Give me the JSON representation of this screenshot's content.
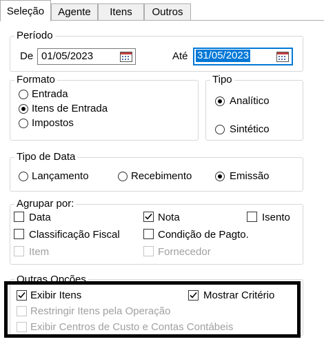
{
  "tabs": [
    "Seleção",
    "Agente",
    "Itens",
    "Outros"
  ],
  "periodo": {
    "legend": "Período",
    "de_label": "De",
    "de_value": "01/05/2023",
    "ate_label": "Até",
    "ate_value": "31/05/2023"
  },
  "formato": {
    "legend": "Formato",
    "options": [
      "Entrada",
      "Itens de Entrada",
      "Impostos"
    ],
    "selected": "Itens de Entrada"
  },
  "tipo": {
    "legend": "Tipo",
    "options": [
      "Analítico",
      "Sintético"
    ],
    "selected": "Analítico"
  },
  "tipo_data": {
    "legend": "Tipo de Data",
    "options": [
      "Lançamento",
      "Recebimento",
      "Emissão"
    ],
    "selected": "Emissão"
  },
  "agrupar": {
    "legend": "Agrupar por:",
    "items": [
      {
        "label": "Data",
        "checked": false,
        "enabled": true
      },
      {
        "label": "Nota",
        "checked": true,
        "enabled": true
      },
      {
        "label": "Isento",
        "checked": false,
        "enabled": true
      },
      {
        "label": "Classificação Fiscal",
        "checked": false,
        "enabled": true
      },
      {
        "label": "Condição de Pagto.",
        "checked": false,
        "enabled": true
      },
      {
        "label": "Item",
        "checked": false,
        "enabled": false
      },
      {
        "label": "Fornecedor",
        "checked": false,
        "enabled": false
      }
    ]
  },
  "outras": {
    "legend": "Outras Opções",
    "items": [
      {
        "label": "Exibir Itens",
        "checked": true,
        "enabled": true
      },
      {
        "label": "Mostrar Critério",
        "checked": true,
        "enabled": true
      },
      {
        "label": "Restringir Itens pela Operação",
        "checked": false,
        "enabled": false
      },
      {
        "label": "Exibir Centros de Custo e Contas Contábeis",
        "checked": false,
        "enabled": false
      }
    ]
  },
  "colors": {
    "accent": "#0078d7",
    "highlight_border": "#000000"
  },
  "icons": {
    "calendar": "calendar-icon",
    "check": "check-icon"
  }
}
